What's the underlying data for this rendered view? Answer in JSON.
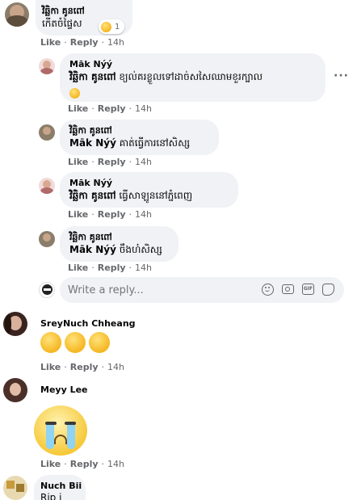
{
  "top_comment": {
    "author": "វិឆ្ឆិកា គូនពៅ",
    "text": "កើតចំផ្ទៃស",
    "reaction_count": "1",
    "actions": {
      "like": "Like",
      "reply": "Reply",
      "time": "14h"
    }
  },
  "replies": [
    {
      "author": "Māk Nýý",
      "tag": "វិឆ្ឆិកា គូនពៅ",
      "text": "ខ្យល់គរខ្លួលទៅដាច់សសៃឈាមខួរក្បាល",
      "actions": {
        "like": "Like",
        "reply": "Reply",
        "time": "14h"
      }
    },
    {
      "author": "វិឆ្ឆិកា គូនពៅ",
      "tag": "Māk Nýý",
      "text": "គាត់ធ្វើការនៅសិស្ស",
      "actions": {
        "like": "Like",
        "reply": "Reply",
        "time": "14h"
      }
    },
    {
      "author": "Māk Nýý",
      "tag": "វិឆ្ឆិកា គូនពៅ",
      "text": "ធ្វើសាឡូននៅភ្នំពេញ",
      "actions": {
        "like": "Like",
        "reply": "Reply",
        "time": "14h"
      }
    },
    {
      "author": "វិឆ្ឆិកា គូនពៅ",
      "tag": "Māk Nýý",
      "text": "ចឹងហ៎សិស្ស",
      "actions": {
        "like": "Like",
        "reply": "Reply",
        "time": "14h"
      }
    }
  ],
  "reply_input": {
    "placeholder": "Write a reply..."
  },
  "comments": [
    {
      "author": "SreyNuch Chheang",
      "actions": {
        "like": "Like",
        "reply": "Reply",
        "time": "14h"
      }
    },
    {
      "author": "Meyy Lee",
      "actions": {
        "like": "Like",
        "reply": "Reply",
        "time": "14h"
      }
    },
    {
      "author": "Nuch Bii",
      "text": "Rip i"
    }
  ],
  "more_options": "···",
  "colors": {
    "bubble": "#f0f2f5",
    "meta": "#65676b",
    "text": "#050505"
  }
}
